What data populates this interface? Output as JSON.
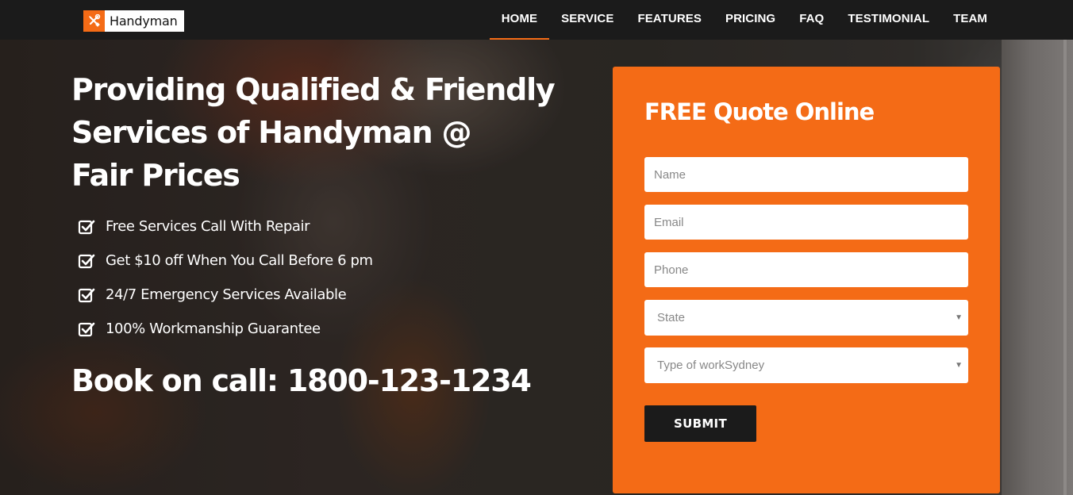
{
  "brand": {
    "name": "Handyman",
    "accent_color": "#f46b16",
    "icon": "tools-icon"
  },
  "nav": {
    "items": [
      {
        "label": "HOME",
        "active": true
      },
      {
        "label": "SERVICE"
      },
      {
        "label": "FEATURES"
      },
      {
        "label": "PRICING"
      },
      {
        "label": "FAQ"
      },
      {
        "label": "TESTIMONIAL"
      },
      {
        "label": "TEAM"
      }
    ]
  },
  "hero": {
    "headline_lines": [
      "Providing Qualified & Friendly",
      "Services of Handyman @",
      "Fair Prices"
    ],
    "features": [
      "Free Services Call With Repair",
      "Get $10 off When You Call Before 6 pm",
      "24/7 Emergency Services Available",
      "100% Workmanship Guarantee"
    ],
    "feature_icon": "check-square-icon",
    "callout": "Book on call: 1800-123-1234"
  },
  "quote_form": {
    "title": "FREE Quote Online",
    "name_placeholder": "Name",
    "email_placeholder": "Email",
    "phone_placeholder": "Phone",
    "state_selected": "State",
    "work_selected": "Type of workSydney",
    "submit_label": "SUBMIT",
    "card_color": "#f46b16",
    "button_color": "#1b1b1b"
  }
}
